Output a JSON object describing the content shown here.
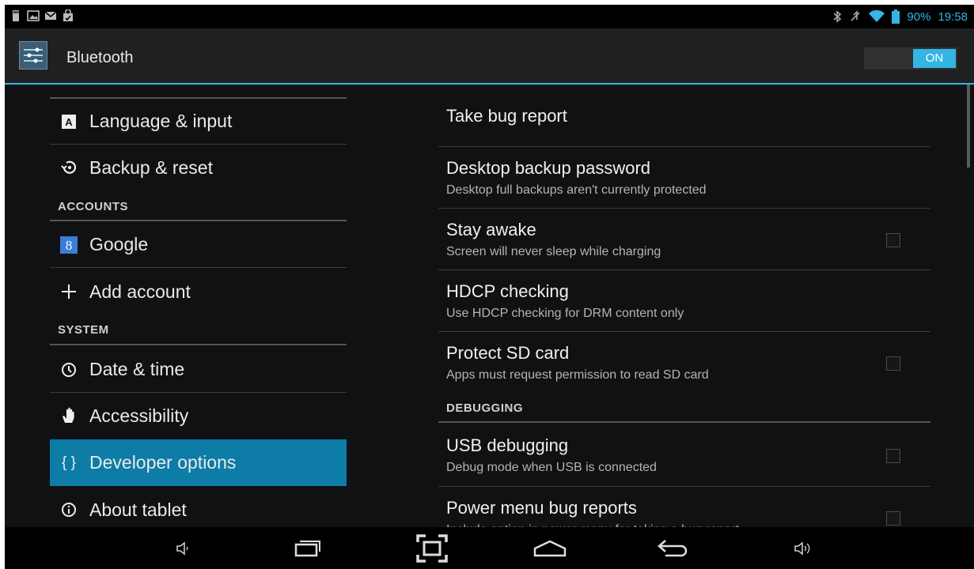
{
  "action_bar": {
    "title": "Bluetooth",
    "toggle_label": "ON"
  },
  "status_bar": {
    "battery": "90%",
    "clock": "19:58"
  },
  "left_pane": {
    "items": [
      {
        "label": "Language & input",
        "icon": "keyboard-a-icon"
      },
      {
        "label": "Backup & reset",
        "icon": "restore-icon"
      },
      {
        "label": "Google",
        "icon": "google-icon"
      },
      {
        "label": "Add account",
        "icon": "plus-icon"
      },
      {
        "label": "Date & time",
        "icon": "clock-icon"
      },
      {
        "label": "Accessibility",
        "icon": "hand-icon"
      },
      {
        "label": "Developer options",
        "icon": "braces-icon",
        "selected": true
      },
      {
        "label": "About tablet",
        "icon": "info-icon"
      }
    ],
    "sections": {
      "accounts": "ACCOUNTS",
      "system": "SYSTEM"
    }
  },
  "right_pane": {
    "items": [
      {
        "title": "Take bug report"
      },
      {
        "title": "Desktop backup password",
        "subtitle": "Desktop full backups aren't currently protected"
      },
      {
        "title": "Stay awake",
        "subtitle": "Screen will never sleep while charging",
        "checked": false
      },
      {
        "title": "HDCP checking",
        "subtitle": "Use HDCP checking for DRM content only"
      },
      {
        "title": "Protect SD card",
        "subtitle": "Apps must request permission to read SD card",
        "checked": false
      },
      {
        "title": "USB debugging",
        "subtitle": "Debug mode when USB is connected",
        "checked": false
      },
      {
        "title": "Power menu bug reports",
        "subtitle": "Include option in power menu for taking a bug report",
        "checked": false
      }
    ],
    "sections": {
      "debugging": "DEBUGGING"
    }
  },
  "colors": {
    "accent": "#33b5e5",
    "selected_bg": "#0d7ca6",
    "background": "#0f1113"
  }
}
